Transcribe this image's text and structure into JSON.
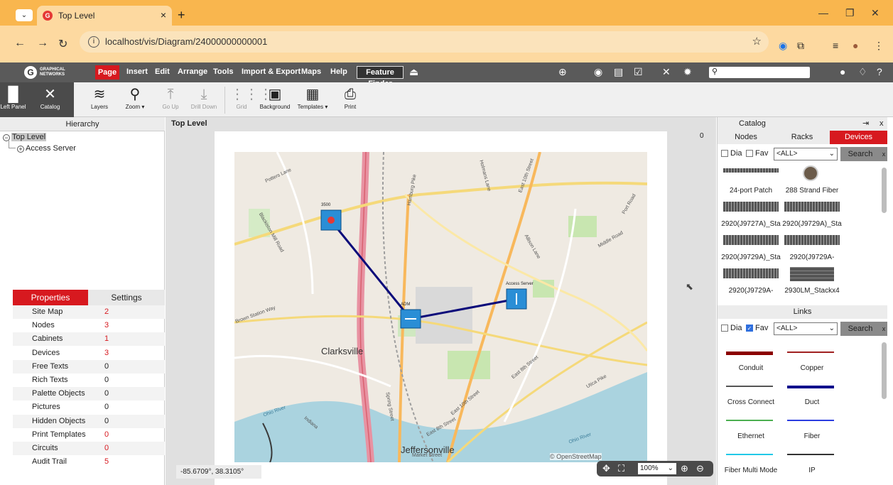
{
  "browser": {
    "tab_title": "Top Level",
    "tab_close": "×",
    "new_tab": "+",
    "url": "localhost/vis/Diagram/24000000000001"
  },
  "app": {
    "logo_line1": "GRAPHICAL",
    "logo_line2": "NETWORKS",
    "menu": {
      "page": "Page",
      "insert": "Insert",
      "edit": "Edit",
      "arrange": "Arrange",
      "tools": "Tools",
      "import_export": "Import & Export",
      "maps": "Maps",
      "help": "Help",
      "feature_finder": "Feature Finder"
    },
    "search_placeholder": ""
  },
  "ribbon": {
    "left_panel": "Left Panel",
    "catalog": "Catalog",
    "layers": "Layers",
    "zoom": "Zoom ▾",
    "go_up": "Go Up",
    "drill_down": "Drill Down",
    "grid": "Grid",
    "background": "Background",
    "templates": "Templates ▾",
    "print": "Print"
  },
  "hierarchy": {
    "title": "Hierarchy",
    "root": "Top Level",
    "child": "Access Server"
  },
  "properties": {
    "tab_properties": "Properties",
    "tab_settings": "Settings",
    "rows": [
      {
        "key": "Site Map",
        "value": "2",
        "highlight": true
      },
      {
        "key": "Nodes",
        "value": "3",
        "highlight": true
      },
      {
        "key": "Cabinets",
        "value": "1",
        "highlight": true
      },
      {
        "key": "Devices",
        "value": "3",
        "highlight": true
      },
      {
        "key": "Free Texts",
        "value": "0",
        "highlight": false
      },
      {
        "key": "Rich Texts",
        "value": "0",
        "highlight": false
      },
      {
        "key": "Palette Objects",
        "value": "0",
        "highlight": false
      },
      {
        "key": "Pictures",
        "value": "0",
        "highlight": false
      },
      {
        "key": "Hidden Objects",
        "value": "0",
        "highlight": false
      },
      {
        "key": "Print Templates",
        "value": "0",
        "highlight": true
      },
      {
        "key": "Circuits",
        "value": "0",
        "highlight": true
      },
      {
        "key": "Audit Trail",
        "value": "5",
        "highlight": true
      }
    ]
  },
  "canvas": {
    "title": "Top Level",
    "counter": "0",
    "coords": "-85.6709°, 38.3105°",
    "zoom": "100%",
    "map_labels": {
      "clarksville": "Clarksville",
      "jeffersonville": "Jeffersonville",
      "attribution": "© OpenStreetMap",
      "potters_lane": "Potters Lane",
      "blackiston_mill": "Blackiston Mill Road",
      "hamburg_pike": "Hamburg Pike",
      "holmans_lane": "Holmans Lane",
      "east_10th_street": "East 10th Street",
      "port_road": "Port Road",
      "middle_road": "Middle Road",
      "allison_lane": "Allison Lane",
      "east_8th_street": "East 8th Street",
      "utica_pike": "Utica Pike",
      "ohio_river": "Ohio River",
      "spring_street": "Spring Street",
      "lewis_station": "Lewis & Clark",
      "market_street": "Market Street",
      "indiana": "Indiana",
      "east_10th_2": "East 10th Street",
      "east_8th_2": "East 8th Street",
      "brown_station": "Brown Station Way"
    },
    "nodes": {
      "n1": "3500",
      "n2": "ADM",
      "n3": "Access Server"
    }
  },
  "catalog": {
    "title": "Catalog",
    "close": "x",
    "tabs": [
      "Nodes",
      "Racks",
      "Devices"
    ],
    "active_tab": "Devices",
    "dia": "Dia",
    "fav": "Fav",
    "select": "<ALL>",
    "search": "Search",
    "x": "x",
    "devices": [
      "24-port Patch",
      "288 Strand Fiber",
      "2920(J9727A)_Sta",
      "2920(J9729A)_Sta",
      "2920(J9729A)_Sta",
      "2920(J9729A-",
      "2920(J9729A-",
      "2930LM_Stackx4"
    ],
    "links_title": "Links",
    "links_select": "<ALL>",
    "links_search": "Search",
    "links": [
      {
        "name": "Conduit",
        "color": "#8b0000",
        "width": 5
      },
      {
        "name": "Copper",
        "color": "#a02020",
        "width": 2
      },
      {
        "name": "Cross Connect",
        "color": "#555555",
        "width": 2
      },
      {
        "name": "Duct",
        "color": "#00008b",
        "width": 4
      },
      {
        "name": "Ethernet",
        "color": "#4caf50",
        "width": 2
      },
      {
        "name": "Fiber",
        "color": "#2b3de0",
        "width": 2
      },
      {
        "name": "Fiber Multi Mode",
        "color": "#21c8e8",
        "width": 2
      },
      {
        "name": "IP",
        "color": "#333333",
        "width": 2
      }
    ]
  }
}
